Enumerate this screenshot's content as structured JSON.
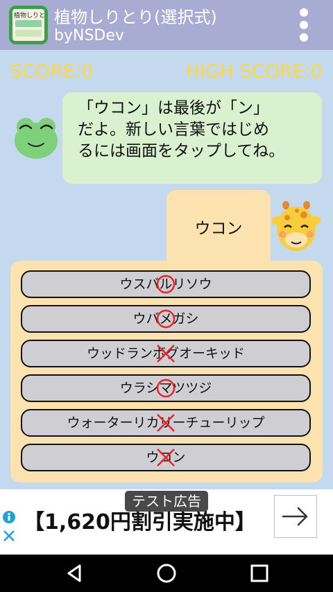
{
  "appbar": {
    "icon_name": "app-icon",
    "icon_text": "植物しりとり",
    "title": "植物しりとり(選択式)",
    "subtitle": "byNSDev",
    "menu_icon": "more-vert-icon"
  },
  "score": {
    "current": "SCORE:0",
    "high": "HIGH SCORE:0",
    "color": "#ffd93b"
  },
  "message": {
    "avatar": "frog-icon",
    "lines": [
      "「ウコン」は最後が「ン」",
      "だよ。新しい言葉ではじめ",
      "るには画面をタップしてね。"
    ]
  },
  "current_word": {
    "avatar": "giraffe-icon",
    "text": "ウコン"
  },
  "choices": [
    {
      "label": "ウスバルリソウ",
      "mark": "circle"
    },
    {
      "label": "ウバメガシ",
      "mark": "circle"
    },
    {
      "label": "ウッドランボグオーキッド",
      "mark": "cross"
    },
    {
      "label": "ウラシマツツジ",
      "mark": "circle"
    },
    {
      "label": "ウォーターリカリーチューリップ",
      "mark": "cross"
    },
    {
      "label": "ウコン",
      "mark": "cross"
    }
  ],
  "ad": {
    "badge": "テスト広告",
    "text": "【1,620円割引実施中】",
    "info_icon": "info-icon",
    "arrow_icon": "arrow-right-icon"
  },
  "navbar": {
    "back_icon": "back-icon",
    "home_icon": "home-icon",
    "recents_icon": "recents-icon"
  }
}
